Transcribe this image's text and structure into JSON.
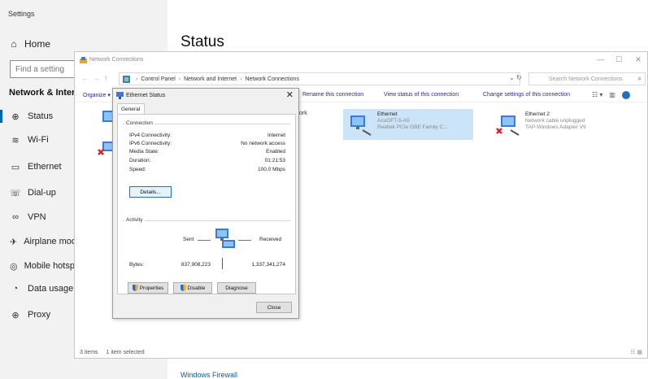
{
  "settings": {
    "window_title": "Settings",
    "home_label": "Home",
    "search_placeholder": "Find a setting",
    "section_title": "Network & Internet",
    "nav_items": [
      {
        "label": "Status",
        "icon": "globe-icon"
      },
      {
        "label": "Wi-Fi",
        "icon": "wifi-icon"
      },
      {
        "label": "Ethernet",
        "icon": "ethernet-icon"
      },
      {
        "label": "Dial-up",
        "icon": "phone-icon"
      },
      {
        "label": "VPN",
        "icon": "vpn-icon"
      },
      {
        "label": "Airplane mode",
        "icon": "airplane-icon"
      },
      {
        "label": "Mobile hotspot",
        "icon": "hotspot-icon"
      },
      {
        "label": "Data usage",
        "icon": "data-usage-icon"
      },
      {
        "label": "Proxy",
        "icon": "globe-icon"
      }
    ],
    "page_heading": "Status",
    "footer_link": "Windows Firewall"
  },
  "network_connections": {
    "title": "Network Connections",
    "breadcrumb": [
      "Control Panel",
      "Network and Internet",
      "Network Connections"
    ],
    "search_placeholder": "Search Network Connections",
    "commands": {
      "organize": "Organize ▾",
      "rename": "Rename this connection",
      "view_status": "View status of this connection",
      "change_settings": "Change settings of this connection"
    },
    "partial_item_label": "ork",
    "connections": [
      {
        "name": "Ethernet",
        "status": "AcuOFT-5-A5",
        "adapter": "Realtek PCIe GBE Family C..."
      },
      {
        "name": "Ethernet 2",
        "status": "Network cable unplugged",
        "adapter": "TAP-Windows Adapter V9"
      }
    ],
    "status_bar": {
      "count": "3 items",
      "selected": "1 item selected"
    }
  },
  "ethernet_status": {
    "title": "Ethernet Status",
    "tab": "General",
    "connection_group": "Connection",
    "rows": [
      {
        "label": "IPv4 Connectivity:",
        "value": "Internet"
      },
      {
        "label": "IPv6 Connectivity:",
        "value": "No network access"
      },
      {
        "label": "Media State:",
        "value": "Enabled"
      },
      {
        "label": "Duration:",
        "value": "01:21:53"
      },
      {
        "label": "Speed:",
        "value": "100.0 Mbps"
      }
    ],
    "details_button": "Details...",
    "activity_group": "Activity",
    "sent_label": "Sent",
    "received_label": "Received",
    "bytes_label": "Bytes:",
    "bytes_sent": "837,908,223",
    "bytes_received": "1,337,341,274",
    "buttons": {
      "properties": "Properties",
      "disable": "Disable",
      "diagnose": "Diagnose",
      "close": "Close"
    }
  }
}
